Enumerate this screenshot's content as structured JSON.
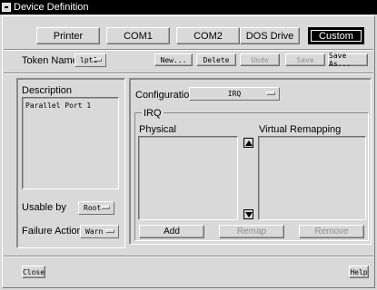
{
  "window": {
    "title": "Device Definition"
  },
  "tabs": [
    {
      "label": "Printer",
      "active": false
    },
    {
      "label": "COM1",
      "active": false
    },
    {
      "label": "COM2",
      "active": false
    },
    {
      "label": "DOS Drive",
      "active": false
    },
    {
      "label": "Custom",
      "active": true
    }
  ],
  "token": {
    "label": "Token Name",
    "value": "lpt1",
    "buttons": {
      "new": "New...",
      "delete": "Delete",
      "undo": "Undo",
      "save": "Save",
      "save_as": "Save As..."
    }
  },
  "description": {
    "label": "Description",
    "text": "Parallel Port 1"
  },
  "usable_by": {
    "label": "Usable by",
    "value": "Root"
  },
  "failure_action": {
    "label": "Failure Action",
    "value": "Warn"
  },
  "configuration": {
    "label": "Configuration",
    "value": "IRQ"
  },
  "irq": {
    "group_label": "IRQ",
    "physical_label": "Physical",
    "virtual_label": "Virtual Remapping",
    "buttons": {
      "add": "Add",
      "remap": "Remap",
      "remove": "Remove"
    }
  },
  "footer": {
    "close": "Close",
    "help": "Help"
  },
  "colors": {
    "window_bg": "#d9d9d9",
    "titlebar_bg": "#000000",
    "active_tab_bg": "#000000",
    "disabled_text": "#8f8f8f"
  }
}
